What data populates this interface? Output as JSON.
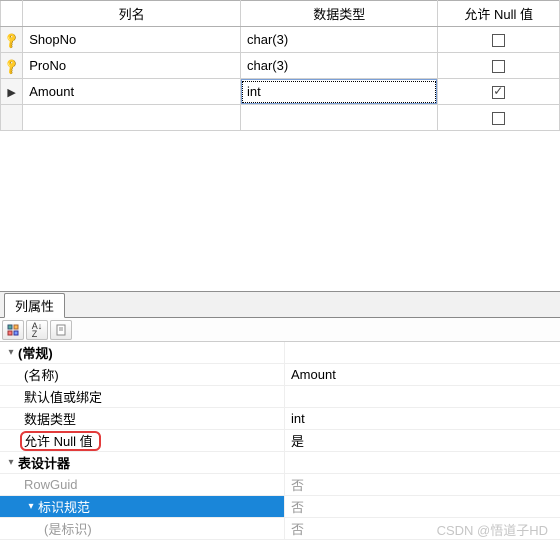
{
  "columns_grid": {
    "headers": {
      "name": "列名",
      "datatype": "数据类型",
      "allownull": "允许 Null 值"
    },
    "rows": [
      {
        "icon": "key",
        "name": "ShopNo",
        "datatype": "char(3)",
        "null_checked": false
      },
      {
        "icon": "key",
        "name": "ProNo",
        "datatype": "char(3)",
        "null_checked": false
      },
      {
        "icon": "arrow",
        "name": "Amount",
        "datatype": "int",
        "null_checked": true,
        "focused": true
      },
      {
        "icon": "",
        "name": "",
        "datatype": "",
        "null_checked": false
      }
    ]
  },
  "properties_panel": {
    "tab_label": "列属性",
    "groups": {
      "general_label": "(常规)",
      "designer_label": "表设计器"
    },
    "items": {
      "name_label": "(名称)",
      "name_value": "Amount",
      "default_label": "默认值或绑定",
      "default_value": "",
      "datatype_label": "数据类型",
      "datatype_value": "int",
      "allownull_label": "允许 Null 值",
      "allownull_value": "是",
      "rowguid_label": "RowGuid",
      "rowguid_value": "否",
      "identity_label": "标识规范",
      "identity_value": "否",
      "isidentity_label": "(是标识)",
      "isidentity_value": "否"
    }
  },
  "watermark": "CSDN @悟道子HD"
}
